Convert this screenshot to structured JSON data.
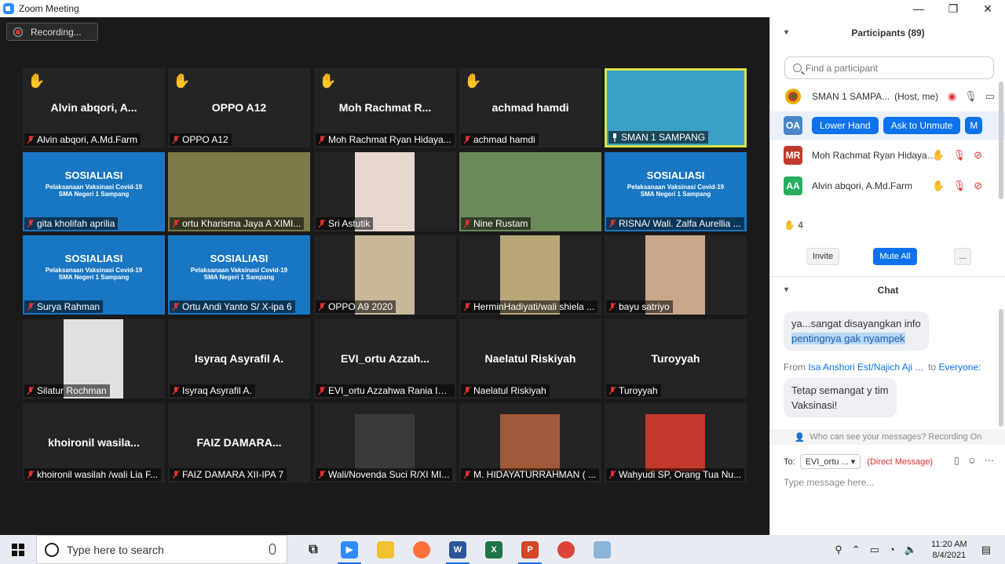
{
  "window": {
    "title": "Zoom Meeting",
    "minimize": "—",
    "maximize": "❐",
    "close": "✕"
  },
  "recording": {
    "label": "Recording..."
  },
  "tiles": [
    {
      "label": "Alvin abqori, A.Md.Farm",
      "bigname": "Alvin abqori, A...",
      "hand": true
    },
    {
      "label": "OPPO A12",
      "bigname": "OPPO A12",
      "hand": true
    },
    {
      "label": "Moh Rachmat Ryan Hidaya...",
      "bigname": "Moh Rachmat R...",
      "hand": true
    },
    {
      "label": "achmad hamdi",
      "bigname": "achmad hamdi",
      "hand": true
    },
    {
      "label": "SMAN 1 SAMPANG",
      "bigname": "",
      "hand": false
    },
    {
      "label": "gita kholifah aprilia",
      "bigname": ""
    },
    {
      "label": "ortu Kharisma Jaya A XIMI...",
      "bigname": ""
    },
    {
      "label": "Sri Astutik",
      "bigname": ""
    },
    {
      "label": "Nine Rustam",
      "bigname": ""
    },
    {
      "label": "RISNA/ Wali. Zalfa Aurellia ...",
      "bigname": ""
    },
    {
      "label": "Surya Rahman",
      "bigname": ""
    },
    {
      "label": "Ortu Andi Yanto S/ X-ipa 6",
      "bigname": ""
    },
    {
      "label": "OPPO A9 2020",
      "bigname": ""
    },
    {
      "label": "HerminHadiyati/wali shiela ...",
      "bigname": ""
    },
    {
      "label": "bayu satriyo",
      "bigname": ""
    },
    {
      "label": "Silatur Rochman",
      "bigname": ""
    },
    {
      "label": "Isyraq Asyrafil A.",
      "bigname": "Isyraq Asyrafil A."
    },
    {
      "label": "EVI_ortu Azzahwa Rania Ins...",
      "bigname": "EVI_ortu  Azzah..."
    },
    {
      "label": "Naelatul Riskiyah",
      "bigname": "Naelatul Riskiyah"
    },
    {
      "label": "Turoyyah",
      "bigname": "Turoyyah"
    },
    {
      "label": "khoironil wasilah /wali Lia F...",
      "bigname": "khoironil  wasila..."
    },
    {
      "label": "FAIZ DAMARA XII-IPA 7",
      "bigname": "FAIZ DAMARA..."
    },
    {
      "label": "Wali/Novenda Suci R/XI MI...",
      "bigname": ""
    },
    {
      "label": "M. HIDAYATURRAHMAN ( ...",
      "bigname": ""
    },
    {
      "label": "Wahyudi SP, Orang Tua Nu...",
      "bigname": ""
    }
  ],
  "banner": {
    "title": "SOSIALIASI",
    "line1": "Pelaksanaan Vaksinasi Covid-19",
    "line2": "SMA Negeri 1 Sampang"
  },
  "participants": {
    "header": "Participants (89)",
    "search_placeholder": "Find a participant",
    "rows": [
      {
        "initials": "",
        "name": "SMAN 1 SAMPA...",
        "role": "(Host, me)",
        "color": "#ffffff"
      },
      {
        "initials": "OA",
        "name": "",
        "color": "#4a86c8",
        "lower_hand": "Lower Hand",
        "ask_unmute": "Ask to Unmute",
        "more": "M"
      },
      {
        "initials": "MR",
        "name": "Moh Rachmat Ryan Hidayat...",
        "color": "#c0392b"
      },
      {
        "initials": "AA",
        "name": "Alvin abqori, A.Md.Farm",
        "color": "#27ae60"
      }
    ],
    "hand_count": "4",
    "invite": "Invite",
    "mute_all": "Mute All",
    "more": "..."
  },
  "chat": {
    "header": "Chat",
    "msg1_a": "ya...sangat disayangkan info",
    "msg1_b": "pentingnya gak nyampek",
    "from_prefix": "From",
    "from_name": "Isa Anshori Est/Najich Aji ...",
    "from_to": "to",
    "from_target": "Everyone:",
    "msg2_a": "Tetap semangat y tim",
    "msg2_b": "Vaksinasi!",
    "who_can_see": "Who can see your messages? Recording On",
    "to_label": "To:",
    "to_value": "EVI_ortu ...",
    "direct_message": "(Direct Message)",
    "type_placeholder": "Type message here..."
  },
  "taskbar": {
    "search_placeholder": "Type here to search",
    "time": "11:20 AM",
    "date": "8/4/2021"
  },
  "colors": {
    "accent": "#0e72ed",
    "active_border": "#d6e34a",
    "bg": "#1a1a1a"
  }
}
